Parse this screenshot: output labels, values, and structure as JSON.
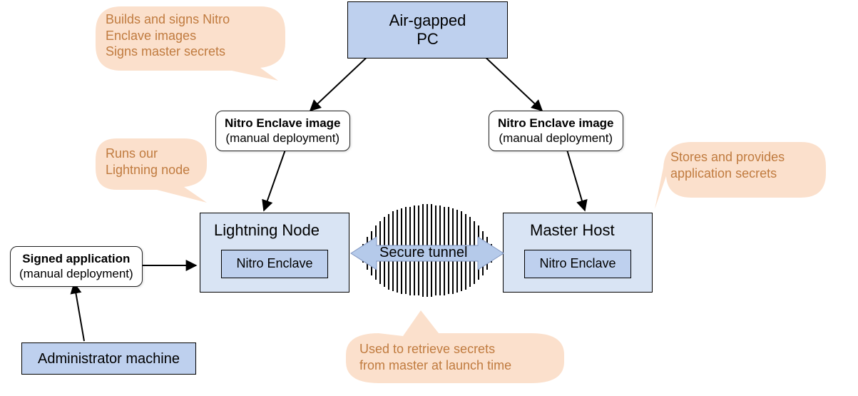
{
  "nodes": {
    "airgapped": {
      "line1": "Air-gapped",
      "line2": "PC"
    },
    "lightning_host": {
      "title": "Lightning Node",
      "enclave_label": "Nitro Enclave"
    },
    "master_host": {
      "title": "Master Host",
      "enclave_label": "Nitro Enclave"
    },
    "admin_machine": {
      "label": "Administrator machine"
    }
  },
  "artifacts": {
    "enclave_image_left": {
      "title": "Nitro Enclave image",
      "note": "(manual deployment)"
    },
    "enclave_image_right": {
      "title": "Nitro Enclave image",
      "note": "(manual deployment)"
    },
    "signed_app": {
      "title": "Signed application",
      "note": "(manual deployment)"
    }
  },
  "tunnel": {
    "label": "Secure tunnel"
  },
  "annotations": {
    "airgapped_desc": "Builds and signs Nitro\nEnclave images\nSigns master secrets",
    "lightning_desc": "Runs our\nLightning node",
    "master_desc": "Stores and provides\napplication secrets",
    "tunnel_desc": "Used to retrieve secrets\nfrom master at launch time"
  },
  "colors": {
    "box_fill": "#bed0ee",
    "host_fill": "#d9e4f4",
    "blob_fill": "#fbe0cc",
    "annotation_text": "#c07b3f",
    "arrow_fill": "#b5caea"
  }
}
